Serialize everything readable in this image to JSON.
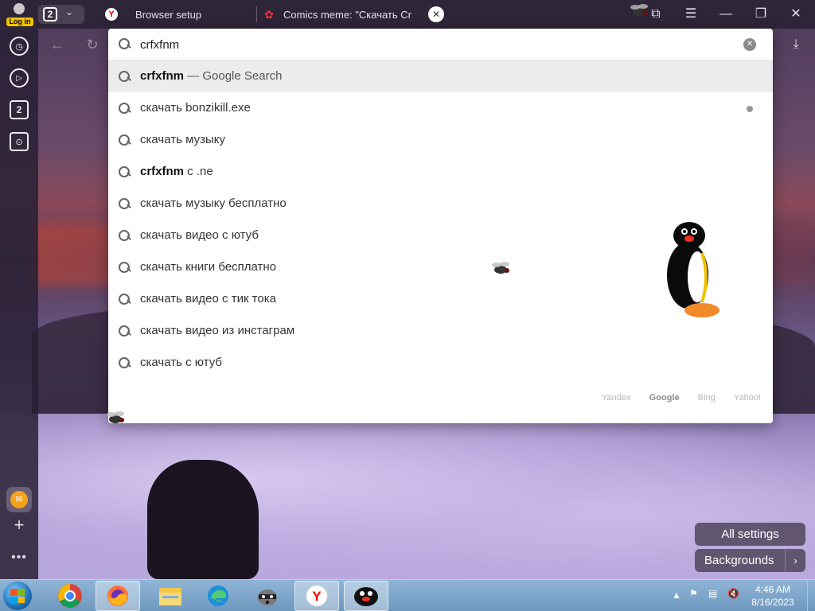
{
  "tabbar": {
    "login_label": "Log in",
    "tab_count": "2",
    "tabs": [
      {
        "title": "Browser setup",
        "icon": "yandex-y-icon"
      },
      {
        "title": "Comics meme: \"Скачать Cr",
        "icon": "comics-icon"
      }
    ],
    "close_glyph": "✕",
    "window_controls": {
      "minimize": "—",
      "maximize": "❐",
      "close": "✕",
      "menu": "☰",
      "bookmarks": "⧉"
    }
  },
  "sidebar": {
    "items": [
      {
        "name": "history",
        "glyph": "◷"
      },
      {
        "name": "media",
        "glyph": "▷"
      },
      {
        "name": "tabs",
        "glyph": "2"
      },
      {
        "name": "screenshot",
        "glyph": "⊙"
      }
    ],
    "add_glyph": "+",
    "more_glyph": "•••"
  },
  "omnibox": {
    "query": "crfxfnm",
    "suggestions": [
      {
        "bold": "crfxfnm",
        "rest": " — Google Search",
        "selected": true
      },
      {
        "bold": "",
        "rest": "скачать bonzikill.exe",
        "dot": true
      },
      {
        "bold": "",
        "rest": "скачать музыку"
      },
      {
        "bold": "crfxfnm",
        "rest": " с .ne"
      },
      {
        "bold": "",
        "rest": "скачать музыку бесплатно"
      },
      {
        "bold": "",
        "rest": "скачать видео с ютуб"
      },
      {
        "bold": "",
        "rest": "скачать книги бесплатно"
      },
      {
        "bold": "",
        "rest": "скачать видео с тик тока"
      },
      {
        "bold": "",
        "rest": "скачать видео из инстаграм"
      },
      {
        "bold": "",
        "rest": "скачать с ютуб"
      }
    ],
    "engines": [
      "Yandex",
      "Google",
      "Bing",
      "Yahoo!"
    ],
    "active_engine": "Google"
  },
  "page": {
    "all_settings_label": "All settings",
    "backgrounds_label": "Backgrounds"
  },
  "taskbar": {
    "time": "4:46 AM",
    "date": "8/16/2023"
  },
  "colors": {
    "accent_yellow": "#f2c200",
    "tabbar_bg": "#2e2538",
    "selected_suggestion_bg": "#ececee"
  }
}
